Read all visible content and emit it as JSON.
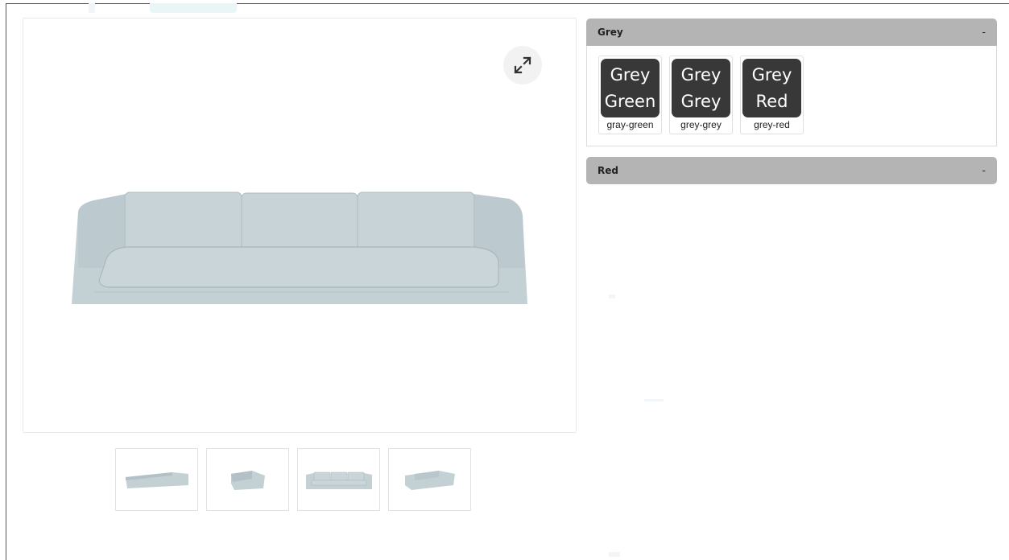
{
  "gallery": {
    "expand_icon": "expand-arrows-icon",
    "thumbnails": [
      {
        "name": "sofa-side-view",
        "icon": "sofa-side-thumbnail"
      },
      {
        "name": "sofa-end-view",
        "icon": "sofa-end-thumbnail"
      },
      {
        "name": "sofa-front-view",
        "icon": "sofa-front-thumbnail"
      },
      {
        "name": "sofa-angle-view",
        "icon": "sofa-angle-thumbnail"
      }
    ],
    "sofa_color": "#c3d0d4"
  },
  "accordion": {
    "sections": [
      {
        "title": "Grey",
        "toggle": "-",
        "swatches": [
          {
            "line1": "Grey",
            "line2": "Green",
            "label": "gray-green"
          },
          {
            "line1": "Grey",
            "line2": "Grey",
            "label": "grey-grey"
          },
          {
            "line1": "Grey",
            "line2": "Red",
            "label": "grey-red"
          }
        ]
      },
      {
        "title": "Red",
        "toggle": "-"
      }
    ],
    "header_color": "#b4b4b4",
    "swatch_color": "#383838"
  }
}
